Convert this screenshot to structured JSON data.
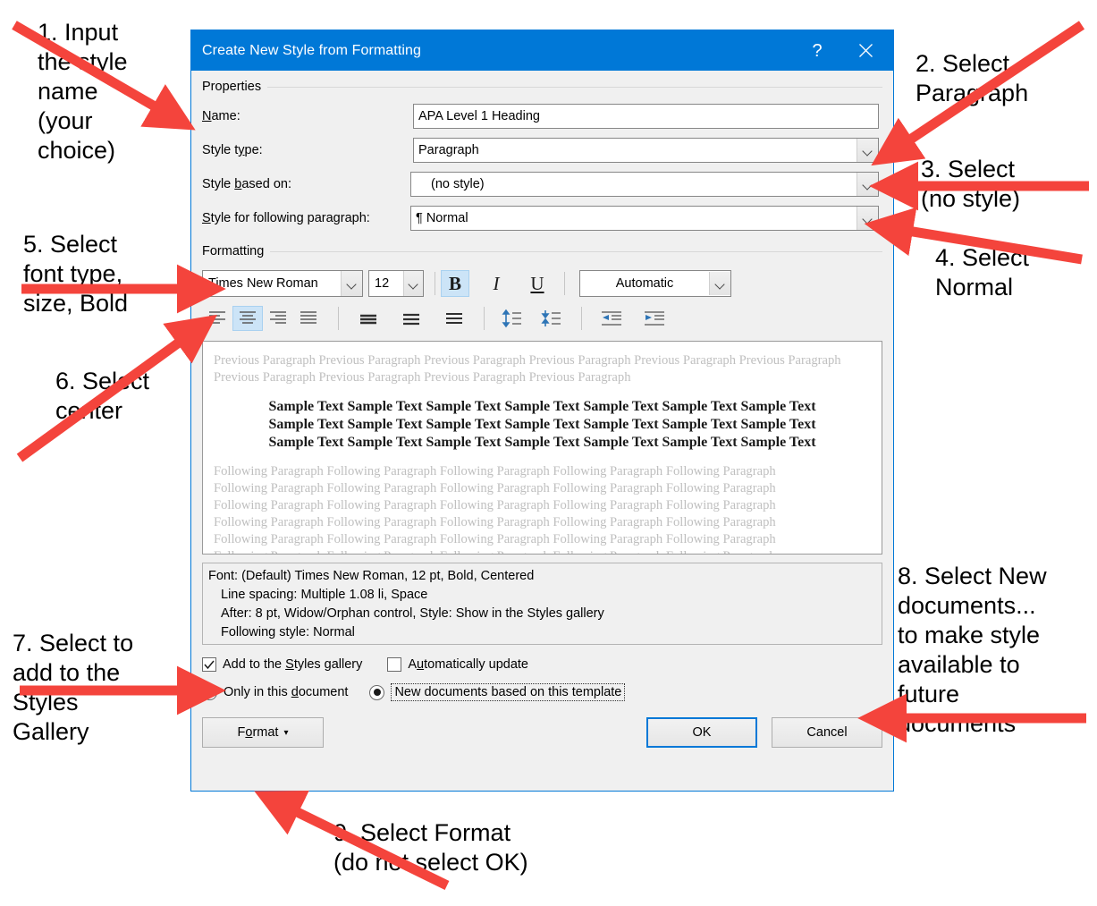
{
  "dialog": {
    "title": "Create New Style from Formatting",
    "help_label": "?",
    "close_label": "✕",
    "properties_group_label": "Properties",
    "formatting_group_label": "Formatting",
    "fields": {
      "name_label": "Name:",
      "name_value": "APA Level 1 Heading",
      "style_type_label": "Style type:",
      "style_type_value": "Paragraph",
      "style_based_on_label": "Style based on:",
      "style_based_on_value": "(no style)",
      "style_following_label": "Style for following paragraph:",
      "style_following_value": "¶ Normal"
    },
    "formatting": {
      "font_family": "Times New Roman",
      "font_size": "12",
      "bold_label": "B",
      "italic_label": "I",
      "underline_label": "U",
      "font_color": "Automatic",
      "bold_active": true,
      "align_active": "center",
      "alignment_buttons": [
        "align-left",
        "align-center",
        "align-right",
        "align-justify"
      ],
      "spacing_buttons": [
        "line-spacing-single",
        "line-spacing-1-5",
        "line-spacing-double"
      ],
      "space_buttons": [
        "increase-paragraph-spacing",
        "decrease-paragraph-spacing"
      ],
      "indent_buttons": [
        "decrease-indent",
        "increase-indent"
      ]
    },
    "preview": {
      "previous_paragraph": "Previous Paragraph Previous Paragraph Previous Paragraph Previous Paragraph Previous Paragraph Previous Paragraph Previous Paragraph Previous Paragraph Previous Paragraph Previous Paragraph",
      "sample_lines": [
        "Sample Text Sample Text Sample Text Sample Text Sample Text Sample Text Sample Text",
        "Sample Text Sample Text Sample Text Sample Text Sample Text Sample Text Sample Text",
        "Sample Text Sample Text Sample Text Sample Text Sample Text Sample Text Sample Text"
      ],
      "following_line": "Following Paragraph Following Paragraph Following Paragraph Following Paragraph Following Paragraph",
      "following_line_count": 7
    },
    "description": [
      "Font: (Default) Times New Roman, 12 pt, Bold, Centered",
      "Line spacing:  Multiple 1.08 li, Space",
      "After:  8 pt, Widow/Orphan control, Style: Show in the Styles gallery",
      "Following style: Normal"
    ],
    "options": {
      "add_to_gallery_label": "Add to the Styles gallery",
      "add_to_gallery_checked": true,
      "auto_update_label": "Automatically update",
      "auto_update_checked": false,
      "only_this_document_label": "Only in this document",
      "only_this_document_selected": false,
      "new_documents_label": "New documents based on this template",
      "new_documents_selected": true
    },
    "buttons": {
      "format_label": "Format",
      "format_caret": "▾",
      "ok_label": "OK",
      "cancel_label": "Cancel"
    }
  },
  "annotations": [
    {
      "id": "ann1",
      "text": "1. Input\nthe style\nname\n(your\nchoice)"
    },
    {
      "id": "ann2",
      "text": "2. Select\nParagraph"
    },
    {
      "id": "ann3",
      "text": "3. Select\n(no style)"
    },
    {
      "id": "ann4",
      "text": "4. Select\nNormal"
    },
    {
      "id": "ann5",
      "text": "5. Select\nfont type,\nsize, Bold"
    },
    {
      "id": "ann6",
      "text": "6. Select\ncenter"
    },
    {
      "id": "ann7",
      "text": "7. Select to\nadd to the\nStyles\nGallery"
    },
    {
      "id": "ann8",
      "text": "8. Select New\ndocuments...\nto make style\navailable to\nfuture\ndocuments"
    },
    {
      "id": "ann9",
      "text": "9. Select Format\n(do not select OK)"
    }
  ],
  "colors": {
    "title_bar": "#0078d7",
    "dialog_bg": "#f0f0f0",
    "accent_selection": "#cce4f7",
    "annotation_arrow": "#f4443c",
    "preview_ghost_text": "#bfbfbf"
  }
}
